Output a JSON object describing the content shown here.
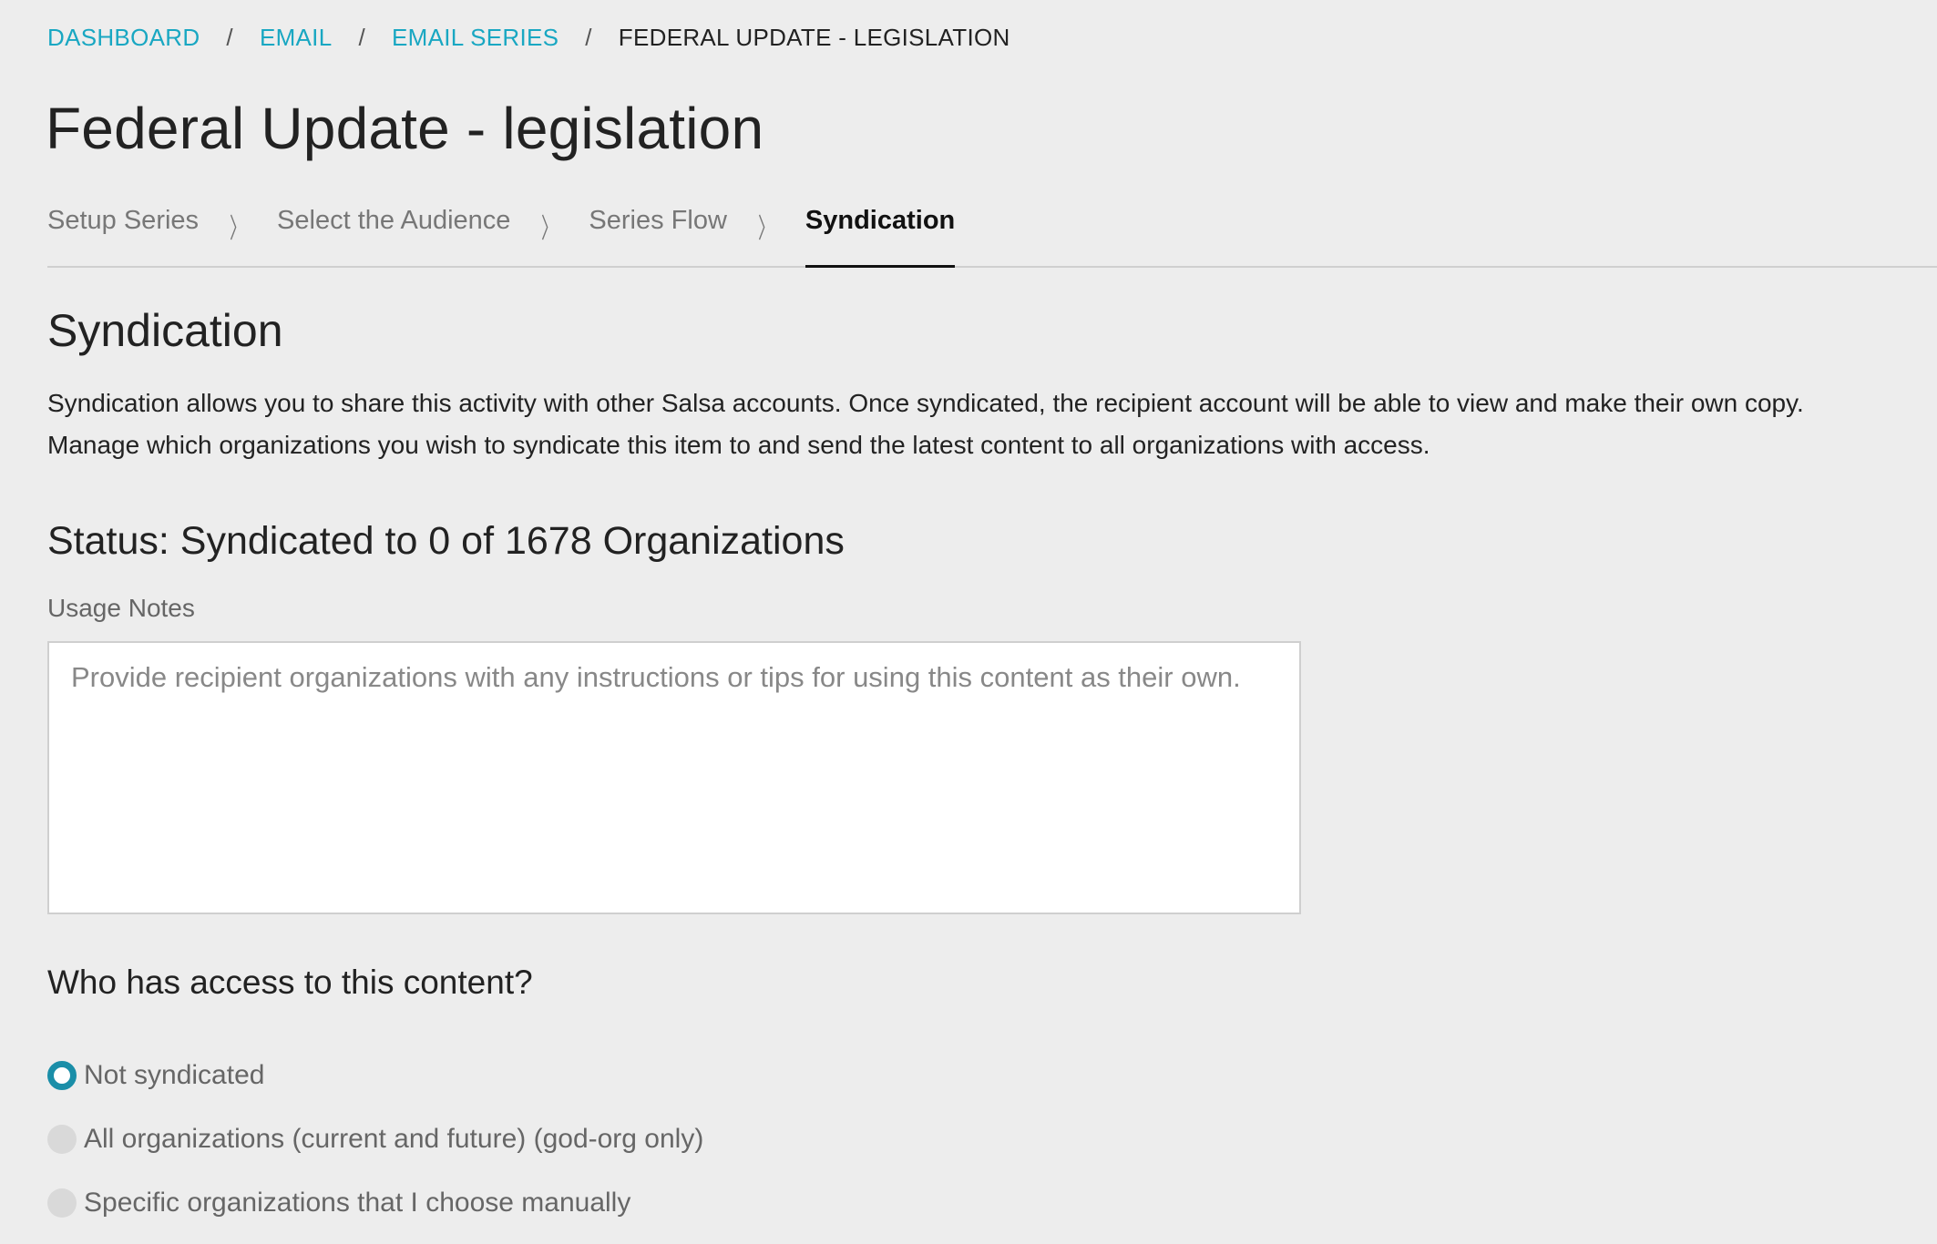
{
  "breadcrumb": {
    "items": [
      "DASHBOARD",
      "EMAIL",
      "EMAIL SERIES"
    ],
    "separator": "/",
    "current": "FEDERAL UPDATE - LEGISLATION"
  },
  "page": {
    "title": "Federal Update - legislation"
  },
  "steps": {
    "items": [
      "Setup Series",
      "Select the Audience",
      "Series Flow",
      "Syndication"
    ],
    "active": "Syndication",
    "chevron": "〉"
  },
  "syndication": {
    "title": "Syndication",
    "description_line1": "Syndication allows you to share this activity with other Salsa accounts. Once syndicated, the recipient account will be able to view and make their own copy.",
    "description_line2": "Manage which organizations you wish to syndicate this item to and send the latest content to all organizations with access.",
    "status": "Status: Syndicated to 0 of 1678 Organizations",
    "usage_notes_label": "Usage Notes",
    "usage_notes_value": "",
    "usage_notes_placeholder": "Provide recipient organizations with any instructions or tips for using this content as their own."
  },
  "access": {
    "title": "Who has access to this content?",
    "options": [
      "Not syndicated",
      "All organizations (current and future) (god-org only)",
      "Specific organizations that I choose manually"
    ],
    "selected": "Not syndicated"
  },
  "colors": {
    "link": "#19a7c2",
    "radio_selected": "#1a8ea8",
    "background": "#ededed"
  }
}
